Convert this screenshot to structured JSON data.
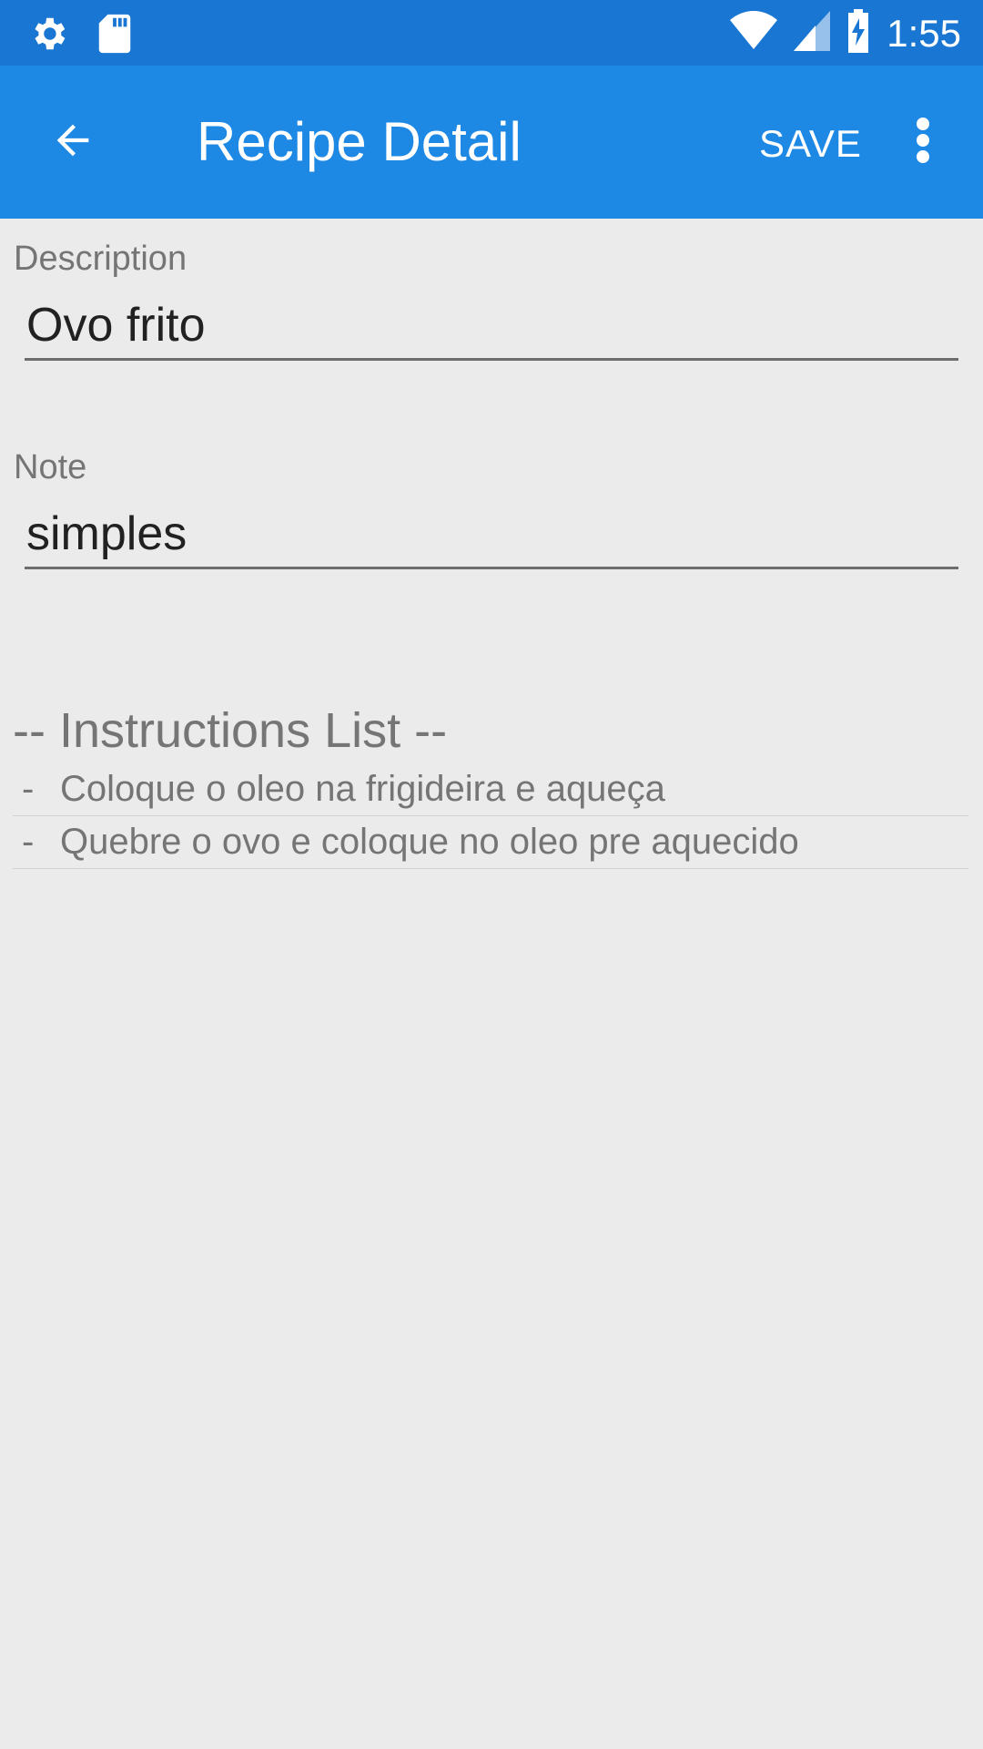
{
  "status_bar": {
    "time": "1:55",
    "icons": [
      "gear-icon",
      "sd-card-icon",
      "wifi-icon",
      "signal-icon",
      "battery-charging-icon"
    ]
  },
  "app_bar": {
    "back_icon": "arrow-back-icon",
    "title": "Recipe Detail",
    "save_label": "SAVE",
    "overflow_icon": "more-vert-icon",
    "color": "#1e88e5"
  },
  "form": {
    "description_label": "Description",
    "description_value": "Ovo frito",
    "note_label": "Note",
    "note_value": "simples"
  },
  "instructions": {
    "title": "-- Instructions List --",
    "items": [
      {
        "dash": "-",
        "text": "Coloque o oleo na frigideira e aqueça"
      },
      {
        "dash": "-",
        "text": "Quebre o ovo e coloque no oleo pre aquecido"
      }
    ]
  }
}
